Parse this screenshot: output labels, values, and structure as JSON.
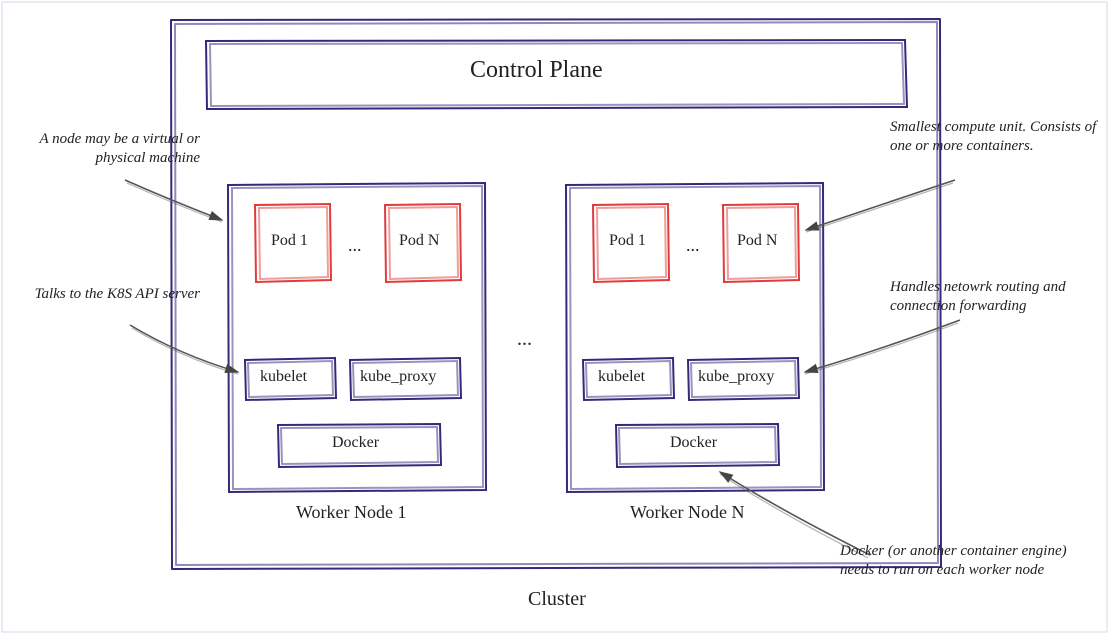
{
  "cluster": {
    "label": "Cluster",
    "control_plane": {
      "label": "Control Plane"
    },
    "ellipsis": "...",
    "nodes": [
      {
        "label": "Worker Node 1",
        "pods": {
          "first": "Pod 1",
          "ellipsis": "...",
          "last": "Pod N"
        },
        "components": {
          "kubelet": "kubelet",
          "kubeproxy": "kube_proxy",
          "docker": "Docker"
        }
      },
      {
        "label": "Worker Node N",
        "pods": {
          "first": "Pod 1",
          "ellipsis": "...",
          "last": "Pod N"
        },
        "components": {
          "kubelet": "kubelet",
          "kubeproxy": "kube_proxy",
          "docker": "Docker"
        }
      }
    ]
  },
  "annotations": {
    "node": "A node may be a virtual or physical machine",
    "kubelet": "Talks to the K8S API server",
    "pod": "Smallest compute unit. Consists of one or more containers.",
    "kubeproxy": "Handles netowrk routing and connection forwarding",
    "docker": "Docker (or another container engine) needs to run on each worker node"
  }
}
